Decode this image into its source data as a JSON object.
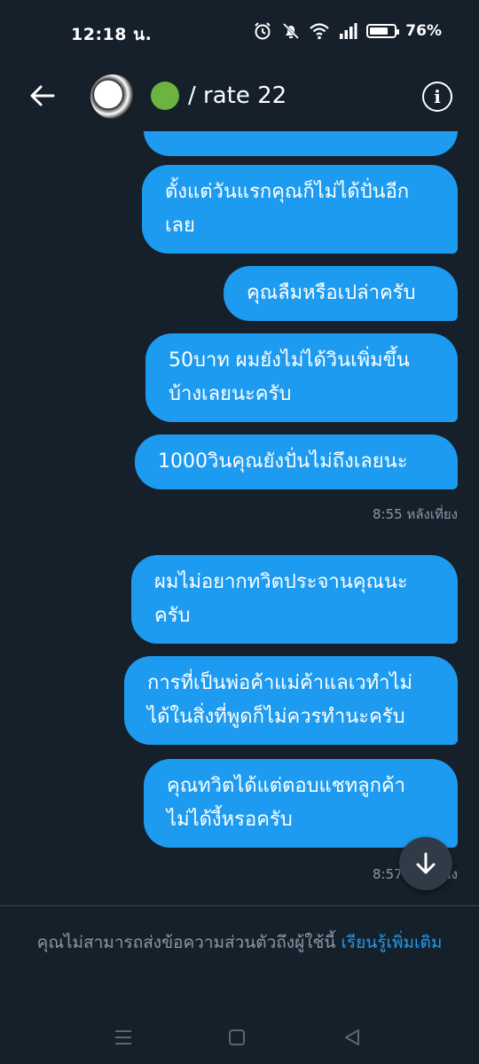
{
  "status_bar": {
    "time": "12:18 น.",
    "battery_percent": "76%",
    "battery_level": 0.76
  },
  "header": {
    "title": "/ rate 22",
    "status_dot_color": "#6cb33f"
  },
  "messages": [
    {
      "text": "ตั้งแต่วันแรกคุณก็ไม่ได้ปั่นอีกเลย",
      "lines": [
        "ตั้งแต่วันแรกคุณก็ไม่ได้ปั่นอีก",
        "เลย"
      ]
    },
    {
      "text": "คุณลืมหรือเปล่าครับ",
      "lines": [
        "คุณลืมหรือเปล่าครับ"
      ]
    },
    {
      "text": "50บาท ผมยังไม่ได้วินเพิ่มขึ้นบ้างเลยนะครับ",
      "lines": [
        "50บาท ผมยังไม่ได้วินเพิ่มขึ้น",
        "บ้างเลยนะครับ"
      ]
    },
    {
      "text": "1000วินคุณยังปั่นไม่ถึงเลยนะ",
      "lines": [
        "1000วินคุณยังปั่นไม่ถึงเลยนะ"
      ]
    },
    {
      "text": "ผมไม่อยากทวิตประจานคุณนะครับ",
      "lines": [
        "ผมไม่อยากทวิตประจานคุณนะ",
        "ครับ"
      ]
    },
    {
      "text": "การที่เป็นพ่อค้าแม่ค้าแลเวทำไม่ได้ในสิ่งที่พูดก็ไม่ควรทำนะครับ",
      "lines": [
        "การที่เป็นพ่อค้าแม่ค้าแลเวทำไม่",
        "ได้ในสิ่งที่พูดก็ไม่ควรทำนะครับ"
      ]
    },
    {
      "text": "คุณทวิตได้แต่ตอบแชทลูกค้าไม่ได้งี้หรอครับ",
      "lines": [
        "คุณทวิตได้แต่ตอบแชทลูกค้า",
        "ไม่ได้งี้หรอครับ"
      ]
    }
  ],
  "timestamps": {
    "first": "8:55 หลังเที่ยง",
    "second": "8:57 หลังเที่ยง"
  },
  "footer": {
    "note": "คุณไม่สามารถส่งข้อความส่วนตัวถึงผู้ใช้นี้",
    "learn_more": "เรียนรู้เพิ่มเติม"
  },
  "colors": {
    "background": "#15202b",
    "bubble": "#1d9bf0",
    "muted_text": "#8b98a5",
    "link": "#1d9bf0"
  },
  "icons": {
    "back": "arrow-left-icon",
    "info": "info-icon",
    "scroll_down": "arrow-down-icon",
    "nav_menu": "menu-icon",
    "nav_home": "square-icon",
    "nav_back": "triangle-back-icon"
  }
}
